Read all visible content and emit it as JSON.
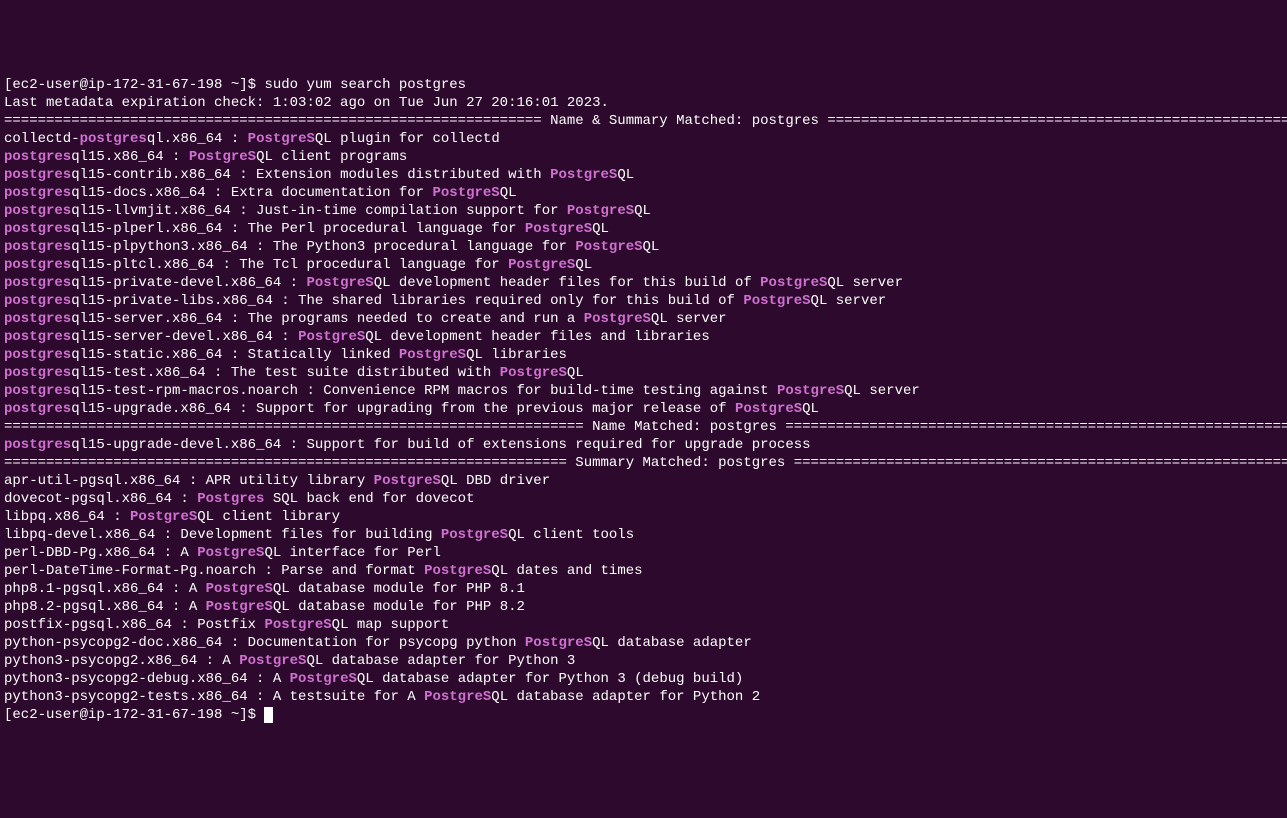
{
  "prompt1": "[ec2-user@ip-172-31-67-198 ~]$ ",
  "command": "sudo yum search postgres",
  "metadata_line": "Last metadata expiration check: 1:03:02 ago on Tue Jun 27 20:16:01 2023.",
  "header_name_summary_eq_left": "================================================================ ",
  "header_name_summary_text": "Name & Summary Matched: postgres",
  "header_name_summary_eq_right": " ================================================================",
  "header_name_eq_left": "===================================================================== ",
  "header_name_text": "Name Matched: postgres",
  "header_name_eq_right": " =====================================================================",
  "header_summary_eq_left": "=================================================================== ",
  "header_summary_text": "Summary Matched: postgres",
  "header_summary_eq_right": " ====================================================================",
  "pkg": {
    "collectd": {
      "pre": "collectd-",
      "hl1": "postgres",
      "mid1": "ql.x86_64 : ",
      "hl2": "PostgreS",
      "post": "QL plugin for collectd"
    },
    "pg15": {
      "hl1": "postgres",
      "mid1": "ql15.x86_64 : ",
      "hl2": "PostgreS",
      "post": "QL client programs"
    },
    "contrib": {
      "hl1": "postgres",
      "mid1": "ql15-contrib.x86_64 : Extension modules distributed with ",
      "hl2": "PostgreS",
      "post": "QL"
    },
    "docs": {
      "hl1": "postgres",
      "mid1": "ql15-docs.x86_64 : Extra documentation for ",
      "hl2": "PostgreS",
      "post": "QL"
    },
    "llvmjit": {
      "hl1": "postgres",
      "mid1": "ql15-llvmjit.x86_64 : Just-in-time compilation support for ",
      "hl2": "PostgreS",
      "post": "QL"
    },
    "plperl": {
      "hl1": "postgres",
      "mid1": "ql15-plperl.x86_64 : The Perl procedural language for ",
      "hl2": "PostgreS",
      "post": "QL"
    },
    "plpython3": {
      "hl1": "postgres",
      "mid1": "ql15-plpython3.x86_64 : The Python3 procedural language for ",
      "hl2": "PostgreS",
      "post": "QL"
    },
    "pltcl": {
      "hl1": "postgres",
      "mid1": "ql15-pltcl.x86_64 : The Tcl procedural language for ",
      "hl2": "PostgreS",
      "post": "QL"
    },
    "private_devel": {
      "hl1": "postgres",
      "mid1": "ql15-private-devel.x86_64 : ",
      "hl2": "PostgreS",
      "mid2": "QL development header files for this build of ",
      "hl3": "PostgreS",
      "post": "QL server"
    },
    "private_libs": {
      "hl1": "postgres",
      "mid1": "ql15-private-libs.x86_64 : The shared libraries required only for this build of ",
      "hl2": "PostgreS",
      "post": "QL server"
    },
    "server": {
      "hl1": "postgres",
      "mid1": "ql15-server.x86_64 : The programs needed to create and run a ",
      "hl2": "PostgreS",
      "post": "QL server"
    },
    "server_devel": {
      "hl1": "postgres",
      "mid1": "ql15-server-devel.x86_64 : ",
      "hl2": "PostgreS",
      "post": "QL development header files and libraries"
    },
    "static": {
      "hl1": "postgres",
      "mid1": "ql15-static.x86_64 : Statically linked ",
      "hl2": "PostgreS",
      "post": "QL libraries"
    },
    "test": {
      "hl1": "postgres",
      "mid1": "ql15-test.x86_64 : The test suite distributed with ",
      "hl2": "PostgreS",
      "post": "QL"
    },
    "test_rpm": {
      "hl1": "postgres",
      "mid1": "ql15-test-rpm-macros.noarch : Convenience RPM macros for build-time testing against ",
      "hl2": "PostgreS",
      "post": "QL server"
    },
    "upgrade": {
      "hl1": "postgres",
      "mid1": "ql15-upgrade.x86_64 : Support for upgrading from the previous major release of ",
      "hl2": "PostgreS",
      "post": "QL"
    },
    "upgrade_devel": {
      "hl1": "postgres",
      "mid1": "ql15-upgrade-devel.x86_64 : Support for build of extensions required for upgrade process"
    },
    "apr_util": {
      "pre": "apr-util-pgsql.x86_64 : APR utility library ",
      "hl1": "PostgreS",
      "post": "QL DBD driver"
    },
    "dovecot": {
      "pre": "dovecot-pgsql.x86_64 : ",
      "hl1": "Postgres",
      "post": " SQL back end for dovecot"
    },
    "libpq": {
      "pre": "libpq.x86_64 : ",
      "hl1": "PostgreS",
      "post": "QL client library"
    },
    "libpq_devel": {
      "pre": "libpq-devel.x86_64 : Development files for building ",
      "hl1": "PostgreS",
      "post": "QL client tools"
    },
    "perl_dbd": {
      "pre": "perl-DBD-Pg.x86_64 : A ",
      "hl1": "PostgreS",
      "post": "QL interface for Perl"
    },
    "perl_datetime": {
      "pre": "perl-DateTime-Format-Pg.noarch : Parse and format ",
      "hl1": "PostgreS",
      "post": "QL dates and times"
    },
    "php81": {
      "pre": "php8.1-pgsql.x86_64 : A ",
      "hl1": "PostgreS",
      "post": "QL database module for PHP 8.1"
    },
    "php82": {
      "pre": "php8.2-pgsql.x86_64 : A ",
      "hl1": "PostgreS",
      "post": "QL database module for PHP 8.2"
    },
    "postfix": {
      "pre": "postfix-pgsql.x86_64 : Postfix ",
      "hl1": "PostgreS",
      "post": "QL map support"
    },
    "psycopg2_doc": {
      "pre": "python-psycopg2-doc.x86_64 : Documentation for psycopg python ",
      "hl1": "PostgreS",
      "post": "QL database adapter"
    },
    "psycopg2": {
      "pre": "python3-psycopg2.x86_64 : A ",
      "hl1": "PostgreS",
      "post": "QL database adapter for Python 3"
    },
    "psycopg2_debug": {
      "pre": "python3-psycopg2-debug.x86_64 : A ",
      "hl1": "PostgreS",
      "post": "QL database adapter for Python 3 (debug build)"
    },
    "psycopg2_tests": {
      "pre": "python3-psycopg2-tests.x86_64 : A testsuite for A ",
      "hl1": "PostgreS",
      "post": "QL database adapter for Python 2"
    }
  },
  "prompt2": "[ec2-user@ip-172-31-67-198 ~]$ "
}
